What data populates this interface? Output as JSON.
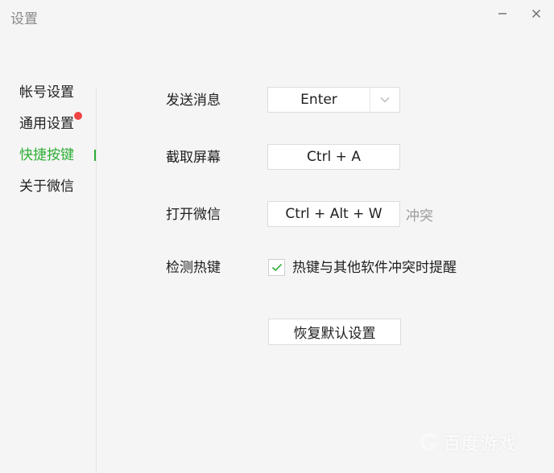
{
  "window": {
    "title": "设置",
    "minimize_icon": "minimize-icon",
    "close_icon": "close-icon"
  },
  "sidebar": {
    "items": [
      {
        "label": "帐号设置",
        "active": false
      },
      {
        "label": "通用设置",
        "active": false,
        "badge": "red-dot"
      },
      {
        "label": "快捷按键",
        "active": true
      },
      {
        "label": "关于微信",
        "active": false
      }
    ]
  },
  "shortcuts": {
    "send_message": {
      "label": "发送消息",
      "value": "Enter",
      "type": "dropdown"
    },
    "screenshot": {
      "label": "截取屏幕",
      "value": "Ctrl + A"
    },
    "open_wechat": {
      "label": "打开微信",
      "value": "Ctrl + Alt + W",
      "status": "冲突"
    },
    "detect_hotkeys": {
      "label": "检测热键",
      "checkbox_label": "热键与其他软件冲突时提醒",
      "checked": true
    }
  },
  "reset_button": "恢复默认设置",
  "watermark": "百度游戏",
  "colors": {
    "accent": "#2dae35",
    "badge": "#f04444",
    "muted": "#9b9b9b",
    "background": "#f5f5f5"
  }
}
